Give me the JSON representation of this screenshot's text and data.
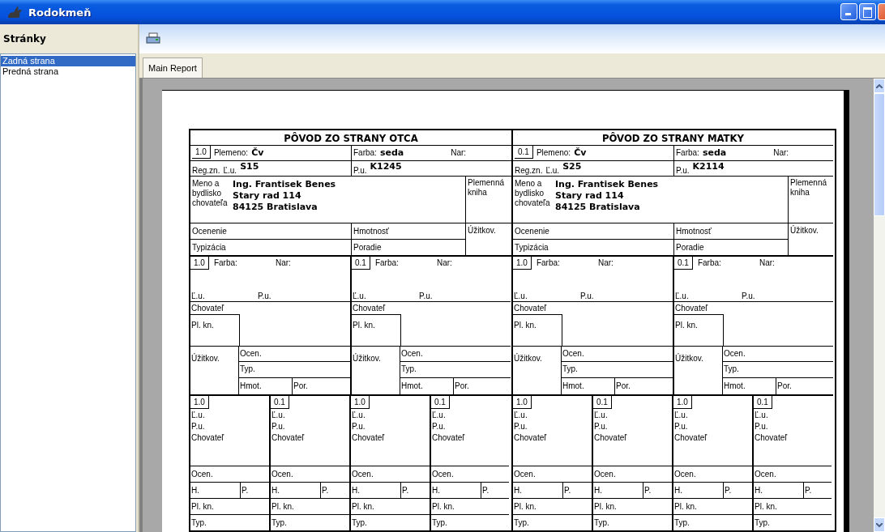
{
  "window": {
    "title": "Rodokmeň"
  },
  "sidebar": {
    "title": "Stránky",
    "items": [
      {
        "label": "Zadná strana",
        "selected": true
      },
      {
        "label": "Predná strana",
        "selected": false
      }
    ]
  },
  "tabs": [
    {
      "label": "Main Report",
      "selected": true
    }
  ],
  "report": {
    "sides": [
      {
        "title": "PÔVOD ZO STRANY OTCA",
        "sex": "1.0",
        "breed_label": "Plemeno:",
        "breed": "Čv",
        "color_label": "Farba:",
        "color_value": "seda",
        "birth_label": "Nar:",
        "reg_label": "Reg.zn.",
        "lu_label": "Ľ.u.",
        "lu": "S15",
        "pu_label": "P.u.",
        "pu": "K1245",
        "breeder_label": "Meno a bydlisko chovateľa",
        "breeder": [
          "Ing. Frantisek Benes",
          "Stary rad 114",
          "84125 Bratislava"
        ],
        "herdbook_label": "Plemenná kniha",
        "rating_label": "Ocenenie",
        "weight_label": "Hmotnosť",
        "use_label": "Úžitkov.",
        "type_label": "Typizácia",
        "rank_label": "Poradie",
        "grandparents": [
          {
            "sex": "1.0",
            "color_label": "Farba:",
            "birth_label": "Nar:",
            "lu_label": "Ľ.u.",
            "pu_label": "P.u.",
            "breeder_label": "Chovateľ",
            "herdbook_label": "Pl. kn.",
            "use_label": "Úžitkov.",
            "rating_label": "Ocen.",
            "type_label": "Typ.",
            "weight_label": "Hmot.",
            "rank_label": "Por."
          },
          {
            "sex": "0.1",
            "color_label": "Farba:",
            "birth_label": "Nar:",
            "lu_label": "Ľ.u.",
            "pu_label": "P.u.",
            "breeder_label": "Chovateľ",
            "herdbook_label": "Pl. kn.",
            "use_label": "Úžitkov.",
            "rating_label": "Ocen.",
            "type_label": "Typ.",
            "weight_label": "Hmot.",
            "rank_label": "Por."
          }
        ],
        "great_grandparents": [
          {
            "sex": "1.0",
            "lu_label": "Ľ.u.",
            "pu_label": "P.u.",
            "breeder_label": "Chovateľ",
            "rating_label": "Ocen.",
            "weight_label": "H.",
            "rank_label": "P.",
            "herdbook_label": "Pl. kn.",
            "type_label": "Typ."
          },
          {
            "sex": "0.1",
            "lu_label": "Ľ.u.",
            "pu_label": "P.u.",
            "breeder_label": "Chovateľ",
            "rating_label": "Ocen.",
            "weight_label": "H.",
            "rank_label": "P.",
            "herdbook_label": "Pl. kn.",
            "type_label": "Typ."
          },
          {
            "sex": "1.0",
            "lu_label": "Ľ.u.",
            "pu_label": "P.u.",
            "breeder_label": "Chovateľ",
            "rating_label": "Ocen.",
            "weight_label": "H.",
            "rank_label": "P.",
            "herdbook_label": "Pl. kn.",
            "type_label": "Typ."
          },
          {
            "sex": "0.1",
            "lu_label": "Ľ.u.",
            "pu_label": "P.u.",
            "breeder_label": "Chovateľ",
            "rating_label": "Ocen.",
            "weight_label": "H.",
            "rank_label": "P.",
            "herdbook_label": "Pl. kn.",
            "type_label": "Typ."
          }
        ]
      },
      {
        "title": "PÔVOD ZO STRANY MATKY",
        "sex": "0.1",
        "breed_label": "Plemeno:",
        "breed": "Čv",
        "color_label": "Farba:",
        "color_value": "seda",
        "birth_label": "Nar:",
        "reg_label": "Reg.zn.",
        "lu_label": "Ľ.u.",
        "lu": "S25",
        "pu_label": "P.u.",
        "pu": "K2114",
        "breeder_label": "Meno a bydlisko chovateľa",
        "breeder": [
          "Ing. Frantisek Benes",
          "Stary rad 114",
          "84125 Bratislava"
        ],
        "herdbook_label": "Plemenná kniha",
        "rating_label": "Ocenenie",
        "weight_label": "Hmotnosť",
        "use_label": "Úžitkov.",
        "type_label": "Typizácia",
        "rank_label": "Poradie",
        "grandparents": [
          {
            "sex": "1.0",
            "color_label": "Farba:",
            "birth_label": "Nar:",
            "lu_label": "Ľ.u.",
            "pu_label": "P.u.",
            "breeder_label": "Chovateľ",
            "herdbook_label": "Pl. kn.",
            "use_label": "Úžitkov.",
            "rating_label": "Ocen.",
            "type_label": "Typ.",
            "weight_label": "Hmot.",
            "rank_label": "Por."
          },
          {
            "sex": "0.1",
            "color_label": "Farba:",
            "birth_label": "Nar:",
            "lu_label": "Ľ.u.",
            "pu_label": "P.u.",
            "breeder_label": "Chovateľ",
            "herdbook_label": "Pl. kn.",
            "use_label": "Úžitkov.",
            "rating_label": "Ocen.",
            "type_label": "Typ.",
            "weight_label": "Hmot.",
            "rank_label": "Por."
          }
        ],
        "great_grandparents": [
          {
            "sex": "1.0",
            "lu_label": "Ľ.u.",
            "pu_label": "P.u.",
            "breeder_label": "Chovateľ",
            "rating_label": "Ocen.",
            "weight_label": "H.",
            "rank_label": "P.",
            "herdbook_label": "Pl. kn.",
            "type_label": "Typ."
          },
          {
            "sex": "0.1",
            "lu_label": "Ľ.u.",
            "pu_label": "P.u.",
            "breeder_label": "Chovateľ",
            "rating_label": "Ocen.",
            "weight_label": "H.",
            "rank_label": "P.",
            "herdbook_label": "Pl. kn.",
            "type_label": "Typ."
          },
          {
            "sex": "1.0",
            "lu_label": "Ľ.u.",
            "pu_label": "P.u.",
            "breeder_label": "Chovateľ",
            "rating_label": "Ocen.",
            "weight_label": "H.",
            "rank_label": "P.",
            "herdbook_label": "Pl. kn.",
            "type_label": "Typ."
          },
          {
            "sex": "0.1",
            "lu_label": "Ľ.u.",
            "pu_label": "P.u.",
            "breeder_label": "Chovateľ",
            "rating_label": "Ocen.",
            "weight_label": "H.",
            "rank_label": "P.",
            "herdbook_label": "Pl. kn.",
            "type_label": "Typ."
          }
        ]
      }
    ]
  }
}
